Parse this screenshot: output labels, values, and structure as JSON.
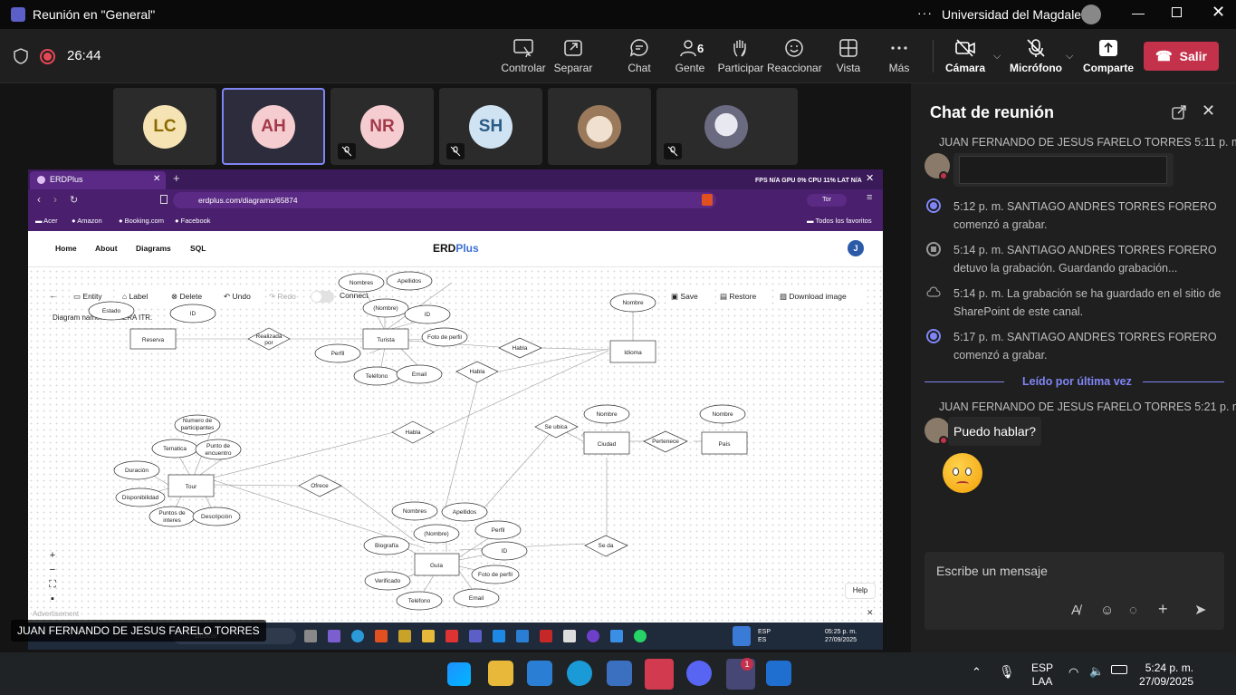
{
  "window": {
    "title": "Reunión en \"General\"",
    "org": "Universidad del Magdalena"
  },
  "toolbar": {
    "timer": "26:44",
    "buttons": [
      {
        "label": "Controlar"
      },
      {
        "label": "Separar"
      },
      {
        "label": "Chat"
      },
      {
        "label": "Gente",
        "count": "6"
      },
      {
        "label": "Participar"
      },
      {
        "label": "Reaccionar"
      },
      {
        "label": "Vista"
      },
      {
        "label": "Más"
      },
      {
        "label": "Cámara"
      },
      {
        "label": "Micrófono"
      },
      {
        "label": "Comparte"
      }
    ],
    "leave": "Salir"
  },
  "participants": [
    {
      "initials": "LC",
      "color": "#f6e3b4",
      "text_color": "#8a6a00"
    },
    {
      "initials": "AH",
      "color": "#f5cdd1",
      "text_color": "#a33a4a"
    },
    {
      "initials": "NR",
      "color": "#f5cdd1",
      "text_color": "#a33a4a"
    },
    {
      "initials": "SH",
      "color": "#cfe3f3",
      "text_color": "#2d5b85"
    }
  ],
  "presenter": "JUAN FERNANDO DE JESUS FARELO TORRES",
  "browser": {
    "tab": "ERDPlus",
    "url": "erdplus.com/diagrams/65874",
    "bookmarks": [
      "Acer",
      "Amazon",
      "Booking.com",
      "Facebook"
    ],
    "all_favs": "Todos los favoritos",
    "stats": "FPS N/A GPU 0% CPU 11% LAT N/A"
  },
  "erd": {
    "nav": [
      "Home",
      "About",
      "Diagrams",
      "SQL"
    ],
    "brand_a": "ERD",
    "brand_b": "Plus",
    "user_initial": "J",
    "tools": [
      "Entity",
      "Label",
      "Delete",
      "Undo",
      "Redo",
      "Connect"
    ],
    "right_tools": [
      "Save",
      "Restore",
      "Download image"
    ],
    "diagram_name": "Diagram name: PRIMERA ITR.",
    "help": "Help",
    "advertisement": "Advertisement",
    "entities": [
      "Reserva",
      "Turista",
      "Idioma",
      "Ciudad",
      "País",
      "Tour",
      "Guía"
    ],
    "relationships": [
      "Realizada por",
      "Habla",
      "Habla",
      "Habla",
      "Se ubica",
      "Pertenece",
      "Ofrece",
      "Se da"
    ],
    "attributes": [
      "Nombres",
      "Apellidos",
      "(Nombre)",
      "ID",
      "ID",
      "Foto de perfil",
      "Perfil",
      "Teléfono",
      "Email",
      "Nombre",
      "Nombre",
      "Nombre",
      "Estado",
      "Numero de participantes",
      "Tematica",
      "Punto de encuentro",
      "Duración",
      "Disponibilidad",
      "Puntos de interes",
      "Descripción",
      "Nombres",
      "Apellidos",
      "(Nombre)",
      "Perfil",
      "ID",
      "Biografía",
      "Foto de perfil",
      "Verificado",
      "Teléfono",
      "Email"
    ]
  },
  "inner_taskbar": {
    "search": "Buscar",
    "lang": "ESP",
    "lang2": "ES",
    "time": "05:25 p. m.",
    "date": "27/09/2025"
  },
  "chat": {
    "title": "Chat de reunión",
    "msg1_header": "JUAN FERNANDO DE JESUS FARELO TORRES  5:11 p. m.",
    "events": [
      {
        "text": "5:12 p. m.    SANTIAGO ANDRES TORRES FORERO comenzó a grabar."
      },
      {
        "text": "5:14 p. m.    SANTIAGO ANDRES TORRES FORERO detuvo la grabación. Guardando grabación..."
      },
      {
        "text": "5:14 p. m.    La grabación se ha guardado en el sitio de SharePoint de este canal."
      },
      {
        "text": "5:17 p. m.    SANTIAGO ANDRES TORRES FORERO comenzó a grabar."
      }
    ],
    "divider": "Leído por última vez",
    "msg2_header": "JUAN FERNANDO DE JESUS FARELO TORRES  5:21 p. m.",
    "msg2_text": "Puedo hablar?",
    "compose_placeholder": "Escribe un mensaje"
  },
  "taskbar": {
    "lang": "ESP",
    "lang2": "LAA",
    "time": "5:24 p. m.",
    "date": "27/09/2025",
    "teams_badge": "1"
  }
}
